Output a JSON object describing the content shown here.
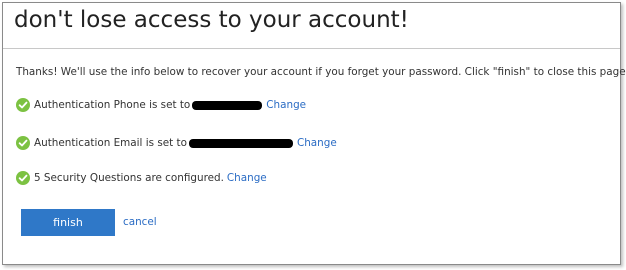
{
  "page": {
    "title": "don't lose access to your account!",
    "intro": "Thanks! We'll use the info below to recover your account if you forget your password. Click \"finish\" to close this page."
  },
  "items": [
    {
      "status": "verified",
      "text": "Authentication Phone is set to",
      "value_redacted": true,
      "link": "Change"
    },
    {
      "status": "verified",
      "text": "Authentication Email is set to",
      "value_redacted": true,
      "link": "Change"
    },
    {
      "status": "verified",
      "text": "5 Security Questions are configured.",
      "value_redacted": false,
      "link": "Change"
    }
  ],
  "actions": {
    "finish_label": "finish",
    "cancel_label": "cancel"
  },
  "colors": {
    "accent": "#2f78c8",
    "link": "#2b6cc4",
    "check": "#7cc242",
    "title_text": "#222222"
  },
  "icons": {
    "status": "check-circle-icon"
  }
}
